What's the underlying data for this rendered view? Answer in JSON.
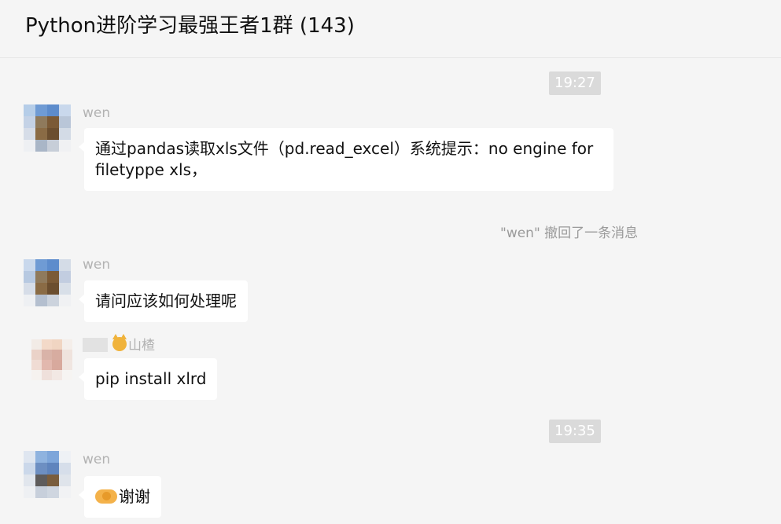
{
  "header": {
    "title": "Python进阶学习最强王者1群 (143)"
  },
  "times": [
    "19:27",
    "19:35"
  ],
  "messages": [
    {
      "sender": "wen",
      "text": "通过pandas读取xls文件（pd.read_excel）系统提示：no engine for filetyppe xls，"
    },
    {
      "sender": "wen",
      "text": "请问应该如何处理呢"
    },
    {
      "sender_suffix": "山楂",
      "text": "pip install xlrd"
    },
    {
      "sender": "wen",
      "text": "谢谢"
    }
  ],
  "recall": {
    "text": "\"wen\" 撤回了一条消息"
  },
  "icons": {
    "cat_emoji": "cat-emoji-icon",
    "handshake_emoji": "handshake-emoji-icon"
  },
  "colors": {
    "background": "#f5f5f5",
    "bubble": "#ffffff",
    "time_badge": "#dadada"
  }
}
